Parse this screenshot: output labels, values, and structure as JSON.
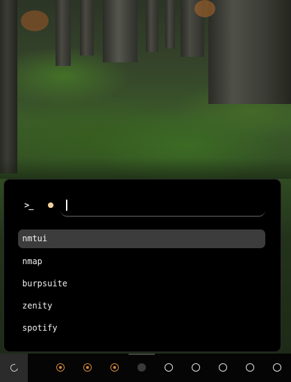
{
  "launcher": {
    "prompt_icon": ">_",
    "query": "",
    "results": [
      {
        "label": "nmtui",
        "selected": true
      },
      {
        "label": "nmap",
        "selected": false
      },
      {
        "label": "burpsuite",
        "selected": false
      },
      {
        "label": "zenity",
        "selected": false
      },
      {
        "label": "spotify",
        "selected": false
      }
    ]
  },
  "taskbar": {
    "start_icon": "start-menu-icon",
    "workspaces": [
      {
        "state": "occupied"
      },
      {
        "state": "occupied"
      },
      {
        "state": "occupied"
      },
      {
        "state": "active"
      },
      {
        "state": "empty"
      },
      {
        "state": "empty"
      },
      {
        "state": "empty"
      },
      {
        "state": "empty"
      },
      {
        "state": "empty"
      }
    ]
  },
  "colors": {
    "accent": "#d98a3a",
    "prompt_dot": "#f2cf9c",
    "selected_row": "#3c3c3c",
    "panel_bg": "#000000"
  }
}
